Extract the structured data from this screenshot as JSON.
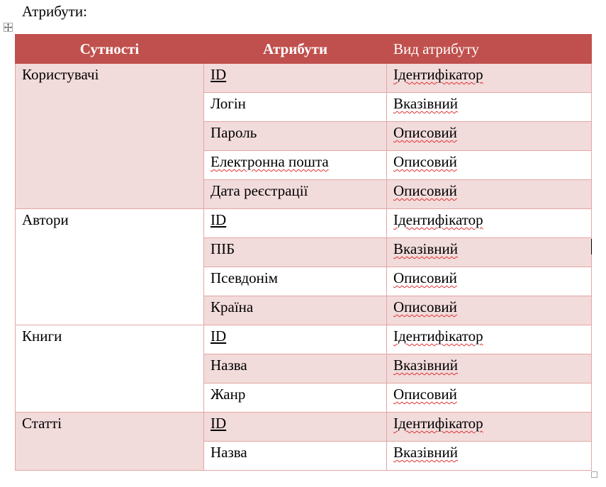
{
  "heading": "Атрибути:",
  "table": {
    "headers": [
      "Сутності",
      "Атрибути",
      "Вид атрибуту"
    ],
    "groups": [
      {
        "entity": "Користувачі",
        "attributes": [
          {
            "name": "ID",
            "type": "Ідентифікатор"
          },
          {
            "name": "Логін",
            "type": "Вказівний"
          },
          {
            "name": "Пароль",
            "type": "Описовий"
          },
          {
            "name": "Електронна пошта",
            "type": "Описовий"
          },
          {
            "name": "Дата реєстрації",
            "type": "Описовий"
          }
        ]
      },
      {
        "entity": "Автори",
        "attributes": [
          {
            "name": "ID",
            "type": "Ідентифікатор"
          },
          {
            "name": "ПІБ",
            "type": "Вказівний"
          },
          {
            "name": "Псевдонім",
            "type": "Описовий"
          },
          {
            "name": "Країна",
            "type": "Описовий"
          }
        ]
      },
      {
        "entity": "Книги",
        "attributes": [
          {
            "name": "ID",
            "type": "Ідентифікатор"
          },
          {
            "name": "Назва",
            "type": "Вказівний"
          },
          {
            "name": "Жанр",
            "type": "Описовий"
          }
        ]
      },
      {
        "entity": "Статті",
        "attributes": [
          {
            "name": "ID",
            "type": "Ідентифікатор"
          },
          {
            "name": "Назва",
            "type": "Вказівний"
          }
        ]
      }
    ]
  },
  "colors": {
    "header_fill": "#c0504d",
    "shaded_row": "#f2dbdb",
    "cell_border": "#e3a6a4",
    "spellcheck": "#e03030"
  },
  "icons": {
    "move_handle": "table-move-icon",
    "resize_handle": "table-resize-icon"
  }
}
